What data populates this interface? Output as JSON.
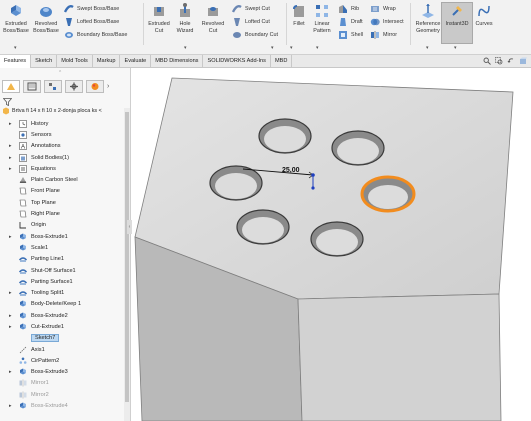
{
  "ribbon": {
    "extruded_boss": "Extruded Boss/Base",
    "revolved_boss": "Revolved Boss/Base",
    "swept_boss": "Swept Boss/Base",
    "lofted_boss": "Lofted Boss/Base",
    "boundary_boss": "Boundary Boss/Base",
    "extruded_cut": "Extruded Cut",
    "hole_wizard": "Hole Wizard",
    "revolved_cut": "Revolved Cut",
    "swept_cut": "Swept Cut",
    "lofted_cut": "Lofted Cut",
    "boundary_cut": "Boundary Cut",
    "fillet": "Fillet",
    "linear_pattern": "Linear Pattern",
    "rib": "Rib",
    "draft": "Draft",
    "shell": "Shell",
    "wrap": "Wrap",
    "intersect": "Intersect",
    "mirror": "Mirror",
    "reference_geometry": "Reference Geometry",
    "curves": "Curves",
    "instant3d": "Instant3D"
  },
  "tabs": [
    "Features",
    "Sketch",
    "Mold Tools",
    "Markup",
    "Evaluate",
    "MBD Dimensions",
    "SOLIDWORKS Add-Ins",
    "MBD"
  ],
  "active_tab": "Features",
  "tree": {
    "root": "Brtva fi 14 x fi 10 x 2-donja ploca ks <",
    "items": [
      {
        "label": "History",
        "expand": "▸",
        "icon": "history"
      },
      {
        "label": "Sensors",
        "expand": "",
        "icon": "sensor"
      },
      {
        "label": "Annotations",
        "expand": "▸",
        "icon": "annotation"
      },
      {
        "label": "Solid Bodies(1)",
        "expand": "▸",
        "icon": "solid"
      },
      {
        "label": "Equations",
        "expand": "▸",
        "icon": "equation"
      },
      {
        "label": "Plain Carbon Steel",
        "expand": "",
        "icon": "material"
      },
      {
        "label": "Front Plane",
        "expand": "",
        "icon": "plane"
      },
      {
        "label": "Top Plane",
        "expand": "",
        "icon": "plane"
      },
      {
        "label": "Right Plane",
        "expand": "",
        "icon": "plane"
      },
      {
        "label": "Origin",
        "expand": "",
        "icon": "origin"
      },
      {
        "label": "Boss-Extrude1",
        "expand": "▸",
        "icon": "feature"
      },
      {
        "label": "Scale1",
        "expand": "",
        "icon": "feature"
      },
      {
        "label": "Parting Line1",
        "expand": "",
        "icon": "mold"
      },
      {
        "label": "Shut-Off Surface1",
        "expand": "",
        "icon": "mold"
      },
      {
        "label": "Parting Surface1",
        "expand": "",
        "icon": "mold"
      },
      {
        "label": "Tooling Split1",
        "expand": "▸",
        "icon": "mold"
      },
      {
        "label": "Body-Delete/Keep 1",
        "expand": "",
        "icon": "feature"
      },
      {
        "label": "Boss-Extrude2",
        "expand": "▸",
        "icon": "feature"
      },
      {
        "label": "Cut-Extrude1",
        "expand": "▸",
        "icon": "feature"
      },
      {
        "label": "Sketch7",
        "expand": "",
        "icon": "",
        "selected": true
      },
      {
        "label": "Axis1",
        "expand": "",
        "icon": "axis"
      },
      {
        "label": "CirPattern2",
        "expand": "",
        "icon": "pattern"
      },
      {
        "label": "Boss-Extrude3",
        "expand": "▸",
        "icon": "feature"
      },
      {
        "label": "Mirror1",
        "expand": "",
        "icon": "mirror",
        "dim": true
      },
      {
        "label": "Mirror2",
        "expand": "",
        "icon": "mirror",
        "dim": true
      },
      {
        "label": "Boss-Extrude4",
        "expand": "▸",
        "icon": "feature",
        "dim": true
      }
    ]
  },
  "viewport": {
    "dimension": "25,00"
  },
  "colors": {
    "accent_selected": "#f28c1e",
    "feature_icon": "#3a6fb5",
    "body": "#d6d6d6"
  }
}
